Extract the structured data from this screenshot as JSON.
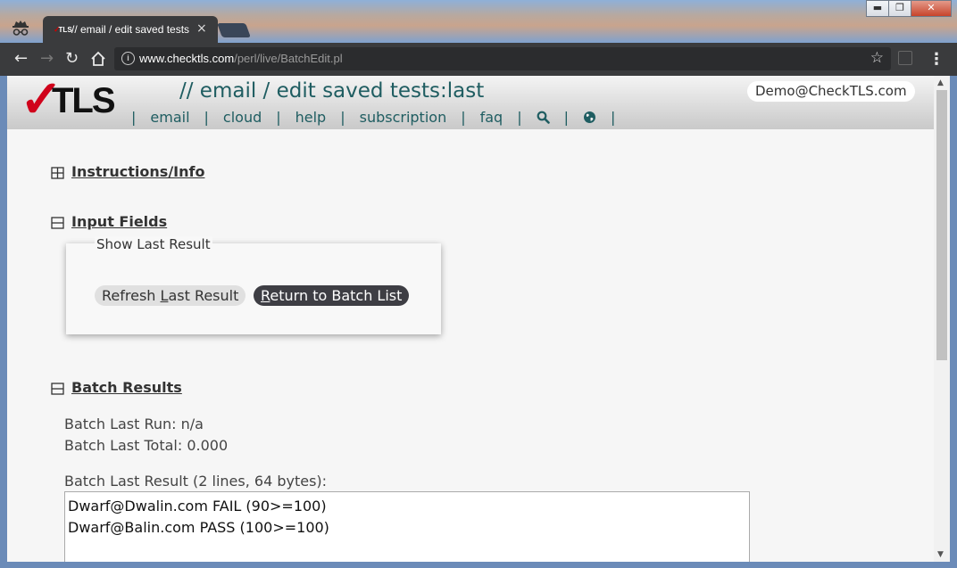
{
  "browser": {
    "tab_title": "// email / edit saved tests",
    "tab_favicon_text": "TLS",
    "url_host": "www.checktls.com",
    "url_path": "/perl/live/BatchEdit.pl",
    "win_minimize": "▬",
    "win_maximize": "❐",
    "win_close": "✕"
  },
  "header": {
    "logo_text": "TLS",
    "heading": "// email / edit saved tests:last",
    "account": "Demo@CheckTLS.com",
    "nav": [
      {
        "label": "email"
      },
      {
        "label": "cloud"
      },
      {
        "label": "help"
      },
      {
        "label": "subscription"
      },
      {
        "label": "faq"
      }
    ],
    "separator": "|"
  },
  "sections": {
    "instructions": {
      "toggle": "⊞",
      "title": "Instructions/Info"
    },
    "input_fields": {
      "toggle": "⊟",
      "title": "Input Fields"
    },
    "batch_results": {
      "toggle": "⊟",
      "title": "Batch Results"
    }
  },
  "show_last_result": {
    "legend": "Show Last Result",
    "refresh_accesskey": "L",
    "refresh_before": "Refresh ",
    "refresh_after": "ast Result",
    "return_accesskey": "R",
    "return_after": "eturn to Batch List"
  },
  "batch": {
    "last_run": "Batch Last Run: n/a",
    "last_total": "Batch Last Total: 0.000",
    "last_result_label": "Batch Last Result (2 lines, 64 bytes):",
    "result_lines": [
      "Dwarf@Dwalin.com FAIL (90>=100)",
      "Dwarf@Balin.com PASS (100>=100)"
    ]
  },
  "colors": {
    "heading": "#1f5d61",
    "logo_check": "#d0021b",
    "return_button": "#3e3e44"
  }
}
